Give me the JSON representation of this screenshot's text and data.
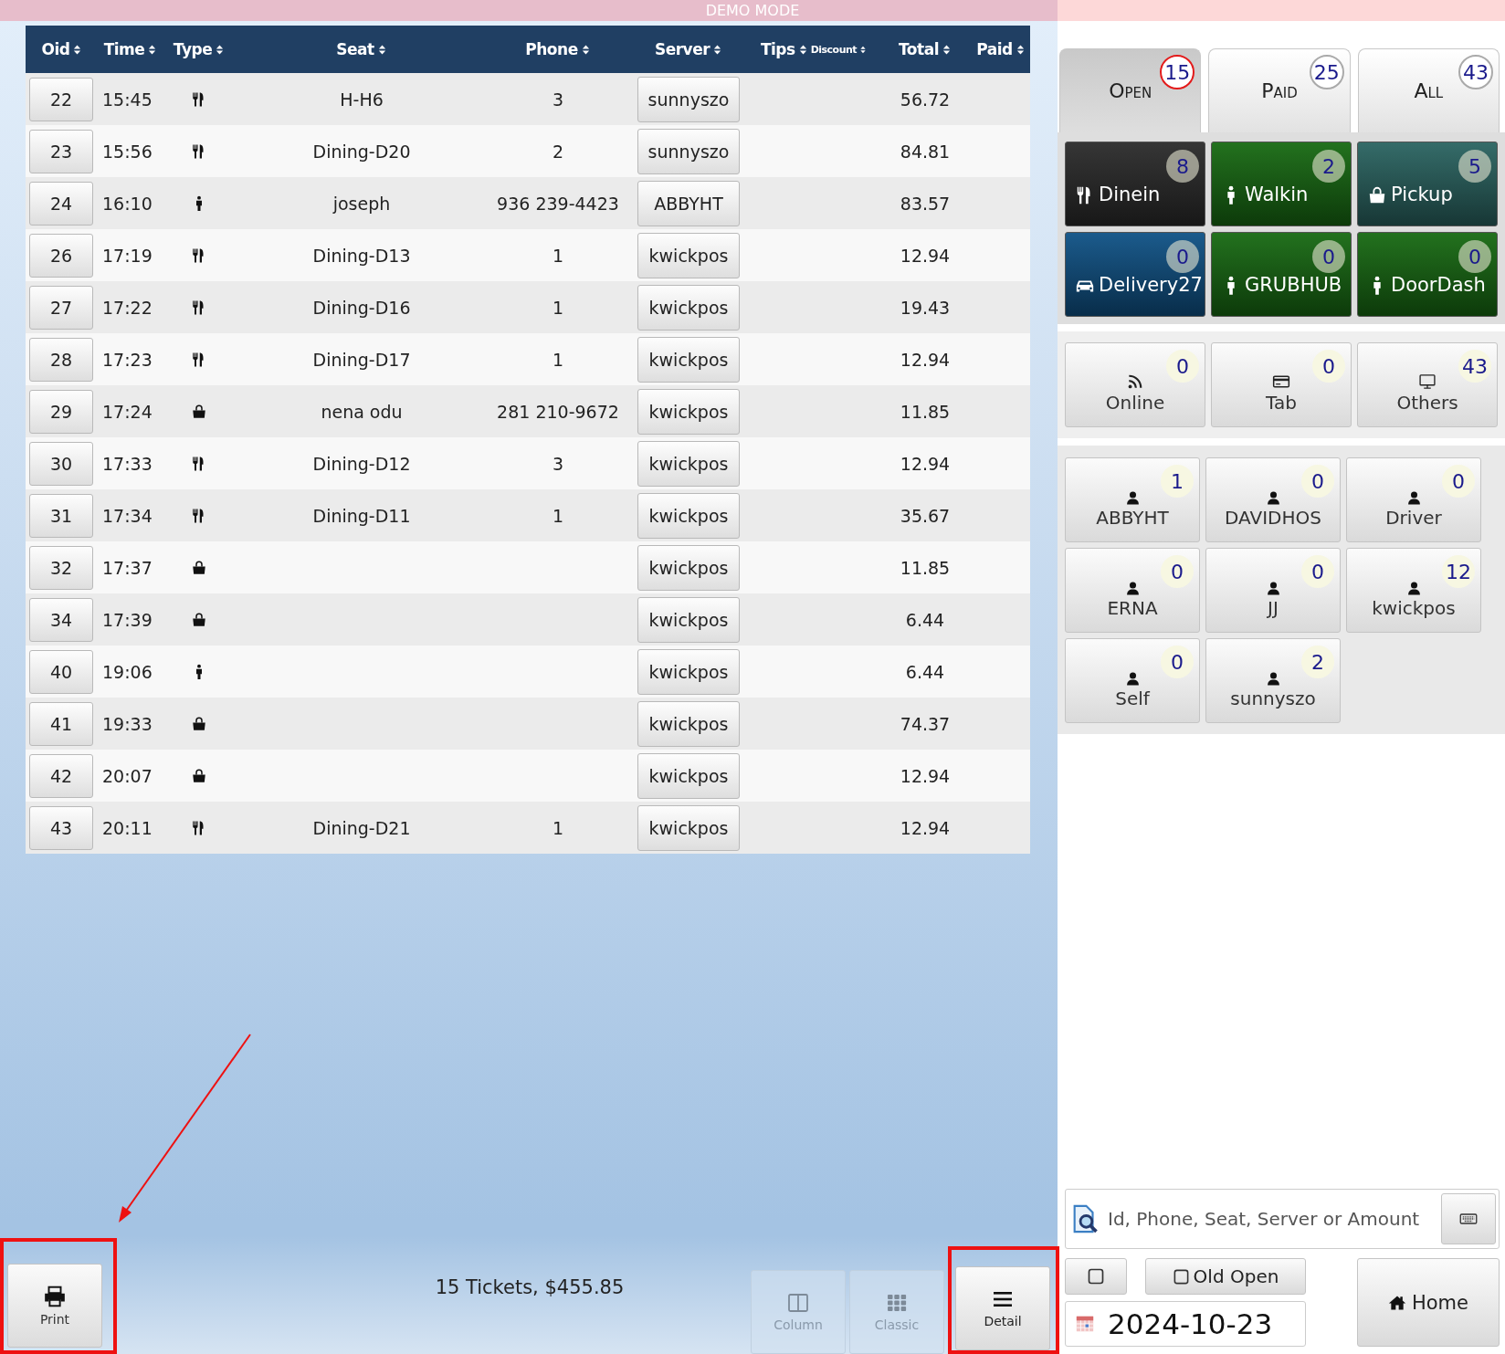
{
  "banner": {
    "text": "DEMO MODE"
  },
  "table": {
    "columns": [
      {
        "label": "Oid"
      },
      {
        "label": "Time"
      },
      {
        "label": "Type"
      },
      {
        "label": "Seat"
      },
      {
        "label": "Phone"
      },
      {
        "label": "Server"
      },
      {
        "label": "Tips",
        "sublabel": "Discount"
      },
      {
        "label": "Total"
      },
      {
        "label": "Paid"
      }
    ],
    "rows": [
      {
        "oid": "22",
        "time": "15:45",
        "kind": "dinein",
        "seat": "H-H6",
        "phone": "3",
        "server": "sunnyszo",
        "total": "56.72"
      },
      {
        "oid": "23",
        "time": "15:56",
        "kind": "dinein",
        "seat": "Dining-D20",
        "phone": "2",
        "server": "sunnyszo",
        "total": "84.81"
      },
      {
        "oid": "24",
        "time": "16:10",
        "kind": "walkin",
        "seat": "joseph",
        "phone": "936 239-4423",
        "server": "ABBYHT",
        "total": "83.57"
      },
      {
        "oid": "26",
        "time": "17:19",
        "kind": "dinein",
        "seat": "Dining-D13",
        "phone": "1",
        "server": "kwickpos",
        "total": "12.94"
      },
      {
        "oid": "27",
        "time": "17:22",
        "kind": "dinein",
        "seat": "Dining-D16",
        "phone": "1",
        "server": "kwickpos",
        "total": "19.43"
      },
      {
        "oid": "28",
        "time": "17:23",
        "kind": "dinein",
        "seat": "Dining-D17",
        "phone": "1",
        "server": "kwickpos",
        "total": "12.94"
      },
      {
        "oid": "29",
        "time": "17:24",
        "kind": "pickup",
        "seat": "nena odu",
        "phone": "281 210-9672",
        "server": "kwickpos",
        "total": "11.85"
      },
      {
        "oid": "30",
        "time": "17:33",
        "kind": "dinein",
        "seat": "Dining-D12",
        "phone": "3",
        "server": "kwickpos",
        "total": "12.94"
      },
      {
        "oid": "31",
        "time": "17:34",
        "kind": "dinein",
        "seat": "Dining-D11",
        "phone": "1",
        "server": "kwickpos",
        "total": "35.67"
      },
      {
        "oid": "32",
        "time": "17:37",
        "kind": "pickup",
        "server": "kwickpos",
        "total": "11.85"
      },
      {
        "oid": "34",
        "time": "17:39",
        "kind": "pickup",
        "server": "kwickpos",
        "total": "6.44"
      },
      {
        "oid": "40",
        "time": "19:06",
        "kind": "walkin",
        "server": "kwickpos",
        "total": "6.44"
      },
      {
        "oid": "41",
        "time": "19:33",
        "kind": "pickup",
        "server": "kwickpos",
        "total": "74.37"
      },
      {
        "oid": "42",
        "time": "20:07",
        "kind": "pickup",
        "server": "kwickpos",
        "total": "12.94"
      },
      {
        "oid": "43",
        "time": "20:11",
        "kind": "dinein",
        "seat": "Dining-D21",
        "phone": "1",
        "server": "kwickpos",
        "total": "12.94"
      }
    ]
  },
  "bottom_bar": {
    "print_button": {
      "label": "Print",
      "highlighted": true,
      "arrow": true
    },
    "summary": "15 Tickets, $455.85",
    "views": [
      {
        "label": "Column",
        "kind": "column",
        "selected": false,
        "highlighted": false
      },
      {
        "label": "Classic",
        "kind": "grid",
        "selected": false,
        "highlighted": false
      },
      {
        "label": "Detail",
        "kind": "list",
        "selected": true,
        "highlighted": true
      }
    ]
  },
  "status_tabs": [
    {
      "label": "Open",
      "count": "15",
      "selected": true
    },
    {
      "label": "Paid",
      "count": "25",
      "selected": false
    },
    {
      "label": "All",
      "count": "43",
      "selected": false
    }
  ],
  "order_types": [
    {
      "label": "Dinein",
      "kind": "dinein",
      "count": "8",
      "color": "#2b2b2b"
    },
    {
      "label": "Walkin",
      "kind": "walkin",
      "count": "2",
      "color": "#176a12"
    },
    {
      "label": "Pickup",
      "kind": "pickup",
      "count": "5",
      "color": "#2a6461"
    },
    {
      "label": "Delivery27",
      "kind": "delivery",
      "count": "0",
      "color": "#0f5286"
    },
    {
      "label": "GRUBHUB",
      "kind": "walkin",
      "count": "0",
      "color": "#176a12"
    },
    {
      "label": "DoorDash",
      "kind": "walkin",
      "count": "0",
      "color": "#176a12"
    }
  ],
  "channels": [
    {
      "label": "Online",
      "kind": "online",
      "count": "0"
    },
    {
      "label": "Tab",
      "kind": "tab",
      "count": "0"
    },
    {
      "label": "Others",
      "kind": "others",
      "count": "43"
    }
  ],
  "servers": [
    {
      "name": "ABBYHT",
      "count": "1"
    },
    {
      "name": "DAVIDHOS",
      "count": "0"
    },
    {
      "name": "Driver",
      "count": "0"
    },
    {
      "name": "ERNA",
      "count": "0"
    },
    {
      "name": "JJ",
      "count": "0"
    },
    {
      "name": "kwickpos",
      "count": "12"
    },
    {
      "name": "Self",
      "count": "0"
    },
    {
      "name": "sunnyszo",
      "count": "2"
    }
  ],
  "search": {
    "placeholder": "Id, Phone, Seat, Server or Amount"
  },
  "blank_checkbox": {
    "checked": false
  },
  "old_open": {
    "label": "Old Open",
    "checked": false
  },
  "date": "2024-10-23",
  "home_button": {
    "label": "Home"
  }
}
